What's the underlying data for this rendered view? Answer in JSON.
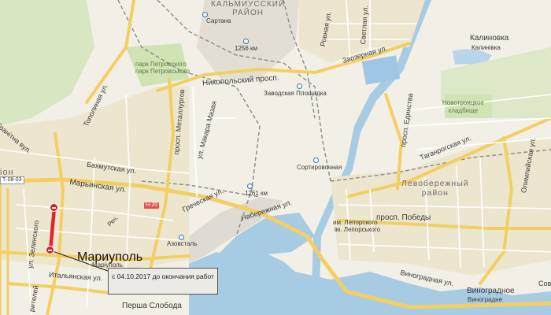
{
  "map": {
    "city_name": "Мариуполь",
    "city_name_small": "Маріуполь",
    "districts": {
      "kalmiusskiy": "КАЛЬМИУССКИЙ\nРАЙОН",
      "levoberezhny": "Левобережный\nрайон",
      "ion": "іон"
    },
    "villages": {
      "kalinovka": "Калиновка",
      "kalinivka": "Калинівка",
      "vinogradnoe": "Виноградное",
      "vinogradne": "Виноградне",
      "sartana": "Сартана",
      "staraya_sloboda": "Перша Слобода",
      "sov": "Сов"
    },
    "streets": {
      "topolinaya": "Тополиная ул.",
      "granitna": "Гранітна вул.",
      "bakhmutskaya": "Бахмутская ул.",
      "marinskaya": "Марьинская ул.",
      "zelinskogo": "ул. Зелинского",
      "italyanskaya": "Итальянская ул.",
      "metallurgov": "просп. Металлургов",
      "makara_mazaya": "ул. Макара Мазая",
      "grecheskaya": "Греческая ул.",
      "nikopolskiy": "Никопольский просп.",
      "naberezhnaya": "Набережная ул.",
      "ediinstva": "просп. Единства",
      "taganrogskaya": "Таганрогская ул.",
      "olimpiyskaya": "Олимпийская ул.",
      "pobedy": "просп. Победы",
      "zaozernaya": "Заозерная ул.",
      "rovnaya": "Ровная ул.",
      "svetlaya": "Светлая ул.",
      "vinogradnaya": "Виноградная ул.",
      "rech": "Реч.",
      "tel": "рителей"
    },
    "places": {
      "park_ru": "парк Петровского",
      "park_ua": "парк Петровського",
      "cemetery": "Новотроицкое\nкладбище",
      "leporskogo_ru": "им. Лепорского",
      "leporskogo_ua": "ім. Лепорського"
    },
    "stations": {
      "km1256": "1256 км",
      "zavodskaya": "Заводская Площадка",
      "sortirovochnaya": "Сортировочная",
      "km1261": "1261 км",
      "azovstal": "Азовсталь",
      "sartana_st": "Сартана"
    },
    "road_shields": {
      "t0803": "Т-08-03",
      "n20": "Н-20"
    },
    "notice": "с 04.10.2017 до окончания работ",
    "colors": {
      "land": "#f2efe6",
      "water": "#a7cbe3",
      "urban": "#ece6d3",
      "industry": "#dcdcdc",
      "green": "#cfe3b5",
      "road_major": "#f6d36b",
      "road_minor": "#ffffff",
      "closure": "#e3242b",
      "rail": "#8c8c8c"
    }
  }
}
